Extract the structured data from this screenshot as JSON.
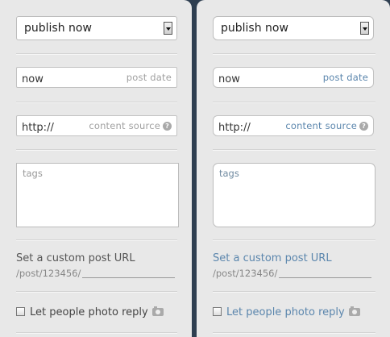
{
  "panels": [
    {
      "publish_select": "publish now",
      "post_date": {
        "value": "now",
        "hint": "post date"
      },
      "content_source": {
        "value": "http://",
        "hint": "content source",
        "help": "?"
      },
      "tags_placeholder": "tags",
      "custom_url_label": "Set a custom post URL",
      "custom_url_prefix": "/post/123456/",
      "photo_reply_label": "Let people photo reply"
    },
    {
      "publish_select": "publish now",
      "post_date": {
        "value": "now",
        "hint": "post date"
      },
      "content_source": {
        "value": "http://",
        "hint": "content source",
        "help": "?"
      },
      "tags_placeholder": "tags",
      "custom_url_label": "Set a custom post URL",
      "custom_url_prefix": "/post/123456/",
      "photo_reply_label": "Let people photo reply"
    }
  ]
}
